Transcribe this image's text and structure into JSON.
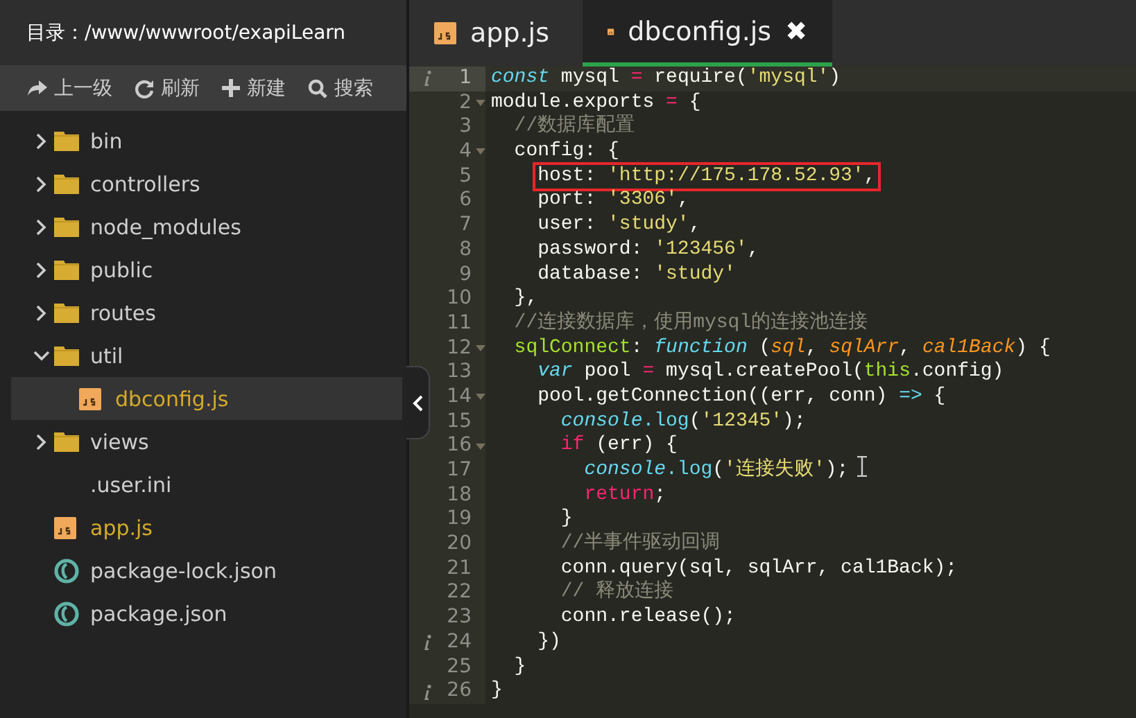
{
  "sidebar": {
    "path_label": "目录：/www/wwwroot/exapiLearn",
    "toolbar": [
      {
        "kind": "up",
        "label": "上一级"
      },
      {
        "kind": "refresh",
        "label": "刷新"
      },
      {
        "kind": "new",
        "label": "新建"
      },
      {
        "kind": "search",
        "label": "搜索"
      }
    ],
    "tree": [
      {
        "kind": "folder",
        "name": "bin",
        "expanded": false,
        "selected": false
      },
      {
        "kind": "folder",
        "name": "controllers",
        "expanded": false,
        "selected": false
      },
      {
        "kind": "folder",
        "name": "node_modules",
        "expanded": false,
        "selected": false
      },
      {
        "kind": "folder",
        "name": "public",
        "expanded": false,
        "selected": false
      },
      {
        "kind": "folder",
        "name": "routes",
        "expanded": false,
        "selected": false
      },
      {
        "kind": "folder",
        "name": "util",
        "expanded": true,
        "selected": false,
        "children": [
          {
            "kind": "js",
            "name": "dbconfig.js",
            "selected": true
          }
        ]
      },
      {
        "kind": "folder",
        "name": "views",
        "expanded": false,
        "selected": false
      },
      {
        "kind": "file",
        "name": ".user.ini",
        "selected": false
      },
      {
        "kind": "js",
        "name": "app.js",
        "selected": false
      },
      {
        "kind": "json",
        "name": "package-lock.json",
        "selected": false
      },
      {
        "kind": "json",
        "name": "package.json",
        "selected": false
      }
    ]
  },
  "tabs": [
    {
      "label": "app.js",
      "selected": false,
      "closable": false
    },
    {
      "label": "dbconfig.js",
      "selected": true,
      "closable": true,
      "close_glyph": "✖"
    }
  ],
  "editor": {
    "lines": [
      {
        "number": "1",
        "fold": false,
        "info": true,
        "current": true,
        "highlighted": false,
        "tokens": [
          {
            "kind": "storage",
            "text": "const"
          },
          {
            "kind": "plain",
            "text": " mysql "
          },
          {
            "kind": "op",
            "text": "="
          },
          {
            "kind": "plain",
            "text": " require("
          },
          {
            "kind": "string",
            "text": "'mysql'"
          },
          {
            "kind": "plain",
            "text": ")"
          }
        ]
      },
      {
        "number": "2",
        "fold": true,
        "info": false,
        "current": false,
        "highlighted": false,
        "tokens": [
          {
            "kind": "plain",
            "text": "module.exports "
          },
          {
            "kind": "op",
            "text": "="
          },
          {
            "kind": "plain",
            "text": " {"
          }
        ]
      },
      {
        "number": "3",
        "fold": false,
        "info": false,
        "current": false,
        "highlighted": false,
        "tokens": [
          {
            "kind": "comment",
            "text": "  //数据库配置"
          }
        ]
      },
      {
        "number": "4",
        "fold": true,
        "info": false,
        "current": false,
        "highlighted": false,
        "tokens": [
          {
            "kind": "plain",
            "text": "  config: {"
          }
        ]
      },
      {
        "number": "5",
        "fold": false,
        "info": false,
        "current": false,
        "highlighted": true,
        "tokens": [
          {
            "kind": "plain",
            "text": "    host: "
          },
          {
            "kind": "string",
            "text": "'http://175.178.52.93'"
          },
          {
            "kind": "plain",
            "text": ","
          }
        ]
      },
      {
        "number": "6",
        "fold": false,
        "info": false,
        "current": false,
        "highlighted": false,
        "tokens": [
          {
            "kind": "plain",
            "text": "    port: "
          },
          {
            "kind": "string",
            "text": "'3306'"
          },
          {
            "kind": "plain",
            "text": ","
          }
        ]
      },
      {
        "number": "7",
        "fold": false,
        "info": false,
        "current": false,
        "highlighted": false,
        "tokens": [
          {
            "kind": "plain",
            "text": "    user: "
          },
          {
            "kind": "string",
            "text": "'study'"
          },
          {
            "kind": "plain",
            "text": ","
          }
        ]
      },
      {
        "number": "8",
        "fold": false,
        "info": false,
        "current": false,
        "highlighted": false,
        "tokens": [
          {
            "kind": "plain",
            "text": "    password: "
          },
          {
            "kind": "string",
            "text": "'123456'"
          },
          {
            "kind": "plain",
            "text": ","
          }
        ]
      },
      {
        "number": "9",
        "fold": false,
        "info": false,
        "current": false,
        "highlighted": false,
        "tokens": [
          {
            "kind": "plain",
            "text": "    database: "
          },
          {
            "kind": "string",
            "text": "'study'"
          }
        ]
      },
      {
        "number": "10",
        "fold": false,
        "info": false,
        "current": false,
        "highlighted": false,
        "tokens": [
          {
            "kind": "plain",
            "text": "  },"
          }
        ]
      },
      {
        "number": "11",
        "fold": false,
        "info": false,
        "current": false,
        "highlighted": false,
        "tokens": [
          {
            "kind": "comment",
            "text": "  //连接数据库，使用mysql的连接池连接"
          }
        ]
      },
      {
        "number": "12",
        "fold": true,
        "info": false,
        "current": false,
        "highlighted": false,
        "tokens": [
          {
            "kind": "func",
            "text": "  sqlConnect"
          },
          {
            "kind": "plain",
            "text": ": "
          },
          {
            "kind": "storage",
            "text": "function"
          },
          {
            "kind": "plain",
            "text": " ("
          },
          {
            "kind": "param",
            "text": "sql"
          },
          {
            "kind": "plain",
            "text": ", "
          },
          {
            "kind": "param",
            "text": "sqlArr"
          },
          {
            "kind": "plain",
            "text": ", "
          },
          {
            "kind": "param",
            "text": "cal1Back"
          },
          {
            "kind": "plain",
            "text": ") {"
          }
        ]
      },
      {
        "number": "13",
        "fold": false,
        "info": false,
        "current": false,
        "highlighted": false,
        "tokens": [
          {
            "kind": "storage",
            "text": "    var"
          },
          {
            "kind": "plain",
            "text": " pool "
          },
          {
            "kind": "op",
            "text": "="
          },
          {
            "kind": "plain",
            "text": " mysql.createPool("
          },
          {
            "kind": "this",
            "text": "this"
          },
          {
            "kind": "plain",
            "text": ".config)"
          }
        ]
      },
      {
        "number": "14",
        "fold": true,
        "info": false,
        "current": false,
        "highlighted": false,
        "tokens": [
          {
            "kind": "plain",
            "text": "    pool.getConnection((err, conn) "
          },
          {
            "kind": "support",
            "text": "=>"
          },
          {
            "kind": "plain",
            "text": " {"
          }
        ]
      },
      {
        "number": "15",
        "fold": false,
        "info": false,
        "current": false,
        "highlighted": false,
        "tokens": [
          {
            "kind": "builtin",
            "text": "      console"
          },
          {
            "kind": "support",
            "text": ".log"
          },
          {
            "kind": "plain",
            "text": "("
          },
          {
            "kind": "string",
            "text": "'12345'"
          },
          {
            "kind": "plain",
            "text": ");"
          }
        ]
      },
      {
        "number": "16",
        "fold": true,
        "info": false,
        "current": false,
        "highlighted": false,
        "tokens": [
          {
            "kind": "keyword",
            "text": "      if"
          },
          {
            "kind": "plain",
            "text": " (err) {"
          }
        ]
      },
      {
        "number": "17",
        "fold": false,
        "info": false,
        "current": false,
        "highlighted": false,
        "mouse_cursor": true,
        "tokens": [
          {
            "kind": "builtin",
            "text": "        console"
          },
          {
            "kind": "support",
            "text": ".log"
          },
          {
            "kind": "plain",
            "text": "("
          },
          {
            "kind": "string",
            "text": "'连接失败'"
          },
          {
            "kind": "plain",
            "text": ");"
          }
        ]
      },
      {
        "number": "18",
        "fold": false,
        "info": false,
        "current": false,
        "highlighted": false,
        "tokens": [
          {
            "kind": "keyword",
            "text": "        return"
          },
          {
            "kind": "plain",
            "text": ";"
          }
        ]
      },
      {
        "number": "19",
        "fold": false,
        "info": false,
        "current": false,
        "highlighted": false,
        "tokens": [
          {
            "kind": "plain",
            "text": "      }"
          }
        ]
      },
      {
        "number": "20",
        "fold": false,
        "info": false,
        "current": false,
        "highlighted": false,
        "tokens": [
          {
            "kind": "comment",
            "text": "      //半事件驱动回调"
          }
        ]
      },
      {
        "number": "21",
        "fold": false,
        "info": false,
        "current": false,
        "highlighted": false,
        "tokens": [
          {
            "kind": "plain",
            "text": "      conn.query(sql, sqlArr, cal1Back);"
          }
        ]
      },
      {
        "number": "22",
        "fold": false,
        "info": false,
        "current": false,
        "highlighted": false,
        "tokens": [
          {
            "kind": "comment",
            "text": "      // 释放连接"
          }
        ]
      },
      {
        "number": "23",
        "fold": false,
        "info": false,
        "current": false,
        "highlighted": false,
        "tokens": [
          {
            "kind": "plain",
            "text": "      conn.release();"
          }
        ]
      },
      {
        "number": "24",
        "fold": false,
        "info": true,
        "current": false,
        "highlighted": false,
        "tokens": [
          {
            "kind": "plain",
            "text": "    })"
          }
        ]
      },
      {
        "number": "25",
        "fold": false,
        "info": false,
        "current": false,
        "highlighted": false,
        "tokens": [
          {
            "kind": "plain",
            "text": "  }"
          }
        ]
      },
      {
        "number": "26",
        "fold": false,
        "info": true,
        "current": false,
        "highlighted": false,
        "tokens": [
          {
            "kind": "plain",
            "text": "}"
          }
        ]
      }
    ]
  }
}
